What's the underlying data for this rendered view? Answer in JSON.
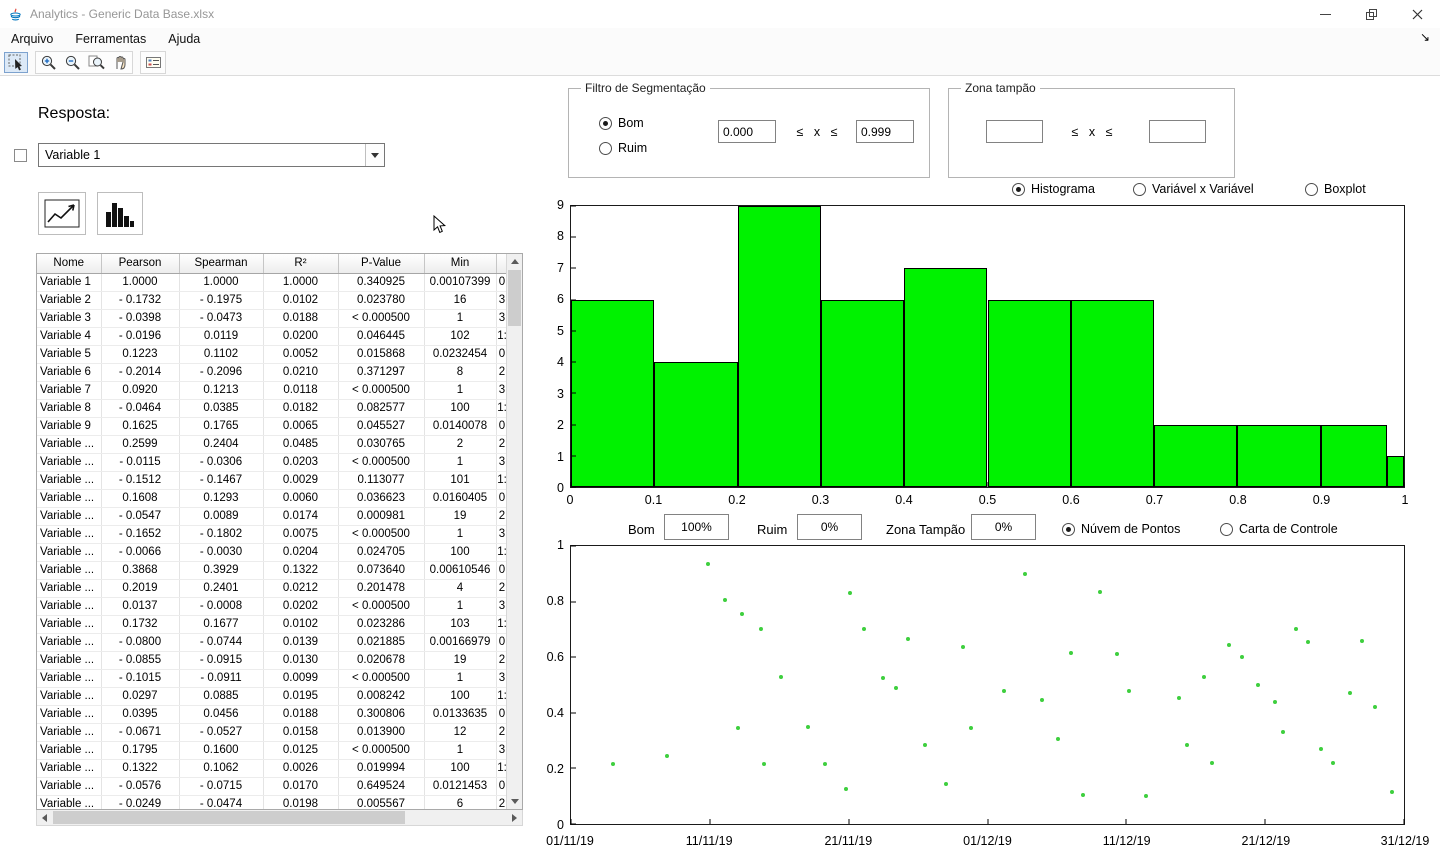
{
  "window": {
    "title": "Analytics - Generic Data Base.xlsx"
  },
  "menu": {
    "arquivo": "Arquivo",
    "ferramentas": "Ferramentas",
    "ajuda": "Ajuda"
  },
  "icons": {
    "dock_arrow": "↘"
  },
  "left_panel": {
    "resposta_label": "Resposta:",
    "variable_selector_value": "Variable 1",
    "table": {
      "headers": [
        "Nome",
        "Pearson",
        "Spearman",
        "R²",
        "P-Value",
        "Min",
        ""
      ],
      "rows": [
        [
          "Variable 1",
          "1.0000",
          "1.0000",
          "1.0000",
          "0.340925",
          "0.00107399",
          "0"
        ],
        [
          "Variable 2",
          "- 0.1732",
          "- 0.1975",
          "0.0102",
          "0.023780",
          "16",
          "3"
        ],
        [
          "Variable 3",
          "- 0.0398",
          "- 0.0473",
          "0.0188",
          "< 0.000500",
          "1",
          "3"
        ],
        [
          "Variable 4",
          "- 0.0196",
          "0.0119",
          "0.0200",
          "0.046445",
          "102",
          "1:"
        ],
        [
          "Variable 5",
          "0.1223",
          "0.1102",
          "0.0052",
          "0.015868",
          "0.0232454",
          "0"
        ],
        [
          "Variable 6",
          "- 0.2014",
          "- 0.2096",
          "0.0210",
          "0.371297",
          "8",
          "2"
        ],
        [
          "Variable 7",
          "0.0920",
          "0.1213",
          "0.0118",
          "< 0.000500",
          "1",
          "3"
        ],
        [
          "Variable 8",
          "- 0.0464",
          "0.0385",
          "0.0182",
          "0.082577",
          "100",
          "1:"
        ],
        [
          "Variable 9",
          "0.1625",
          "0.1765",
          "0.0065",
          "0.045527",
          "0.0140078",
          "0"
        ],
        [
          "Variable ...",
          "0.2599",
          "0.2404",
          "0.0485",
          "0.030765",
          "2",
          "2"
        ],
        [
          "Variable ...",
          "- 0.0115",
          "- 0.0306",
          "0.0203",
          "< 0.000500",
          "1",
          "3"
        ],
        [
          "Variable ...",
          "- 0.1512",
          "- 0.1467",
          "0.0029",
          "0.113077",
          "101",
          "1:"
        ],
        [
          "Variable ...",
          "0.1608",
          "0.1293",
          "0.0060",
          "0.036623",
          "0.0160405",
          "0"
        ],
        [
          "Variable ...",
          "- 0.0547",
          "0.0089",
          "0.0174",
          "0.000981",
          "19",
          "2"
        ],
        [
          "Variable ...",
          "- 0.1652",
          "- 0.1802",
          "0.0075",
          "< 0.000500",
          "1",
          "3"
        ],
        [
          "Variable ...",
          "- 0.0066",
          "- 0.0030",
          "0.0204",
          "0.024705",
          "100",
          "1:"
        ],
        [
          "Variable ...",
          "0.3868",
          "0.3929",
          "0.1322",
          "0.073640",
          "0.00610546",
          "0"
        ],
        [
          "Variable ...",
          "0.2019",
          "0.2401",
          "0.0212",
          "0.201478",
          "4",
          "2"
        ],
        [
          "Variable ...",
          "0.0137",
          "- 0.0008",
          "0.0202",
          "< 0.000500",
          "1",
          "3"
        ],
        [
          "Variable ...",
          "0.1732",
          "0.1677",
          "0.0102",
          "0.023286",
          "103",
          "1:"
        ],
        [
          "Variable ...",
          "- 0.0800",
          "- 0.0744",
          "0.0139",
          "0.021885",
          "0.00166979",
          "0"
        ],
        [
          "Variable ...",
          "- 0.0855",
          "- 0.0915",
          "0.0130",
          "0.020678",
          "19",
          "2"
        ],
        [
          "Variable ...",
          "- 0.1015",
          "- 0.0911",
          "0.0099",
          "< 0.000500",
          "1",
          "3"
        ],
        [
          "Variable ...",
          "0.0297",
          "0.0885",
          "0.0195",
          "0.008242",
          "100",
          "1:"
        ],
        [
          "Variable ...",
          "0.0395",
          "0.0456",
          "0.0188",
          "0.300806",
          "0.0133635",
          "0"
        ],
        [
          "Variable ...",
          "- 0.0671",
          "- 0.0527",
          "0.0158",
          "0.013900",
          "12",
          "2"
        ],
        [
          "Variable ...",
          "0.1795",
          "0.1600",
          "0.0125",
          "< 0.000500",
          "1",
          "3"
        ],
        [
          "Variable ...",
          "0.1322",
          "0.1062",
          "0.0026",
          "0.019994",
          "100",
          "1:"
        ],
        [
          "Variable ...",
          "- 0.0576",
          "- 0.0715",
          "0.0170",
          "0.649524",
          "0.0121453",
          "0"
        ],
        [
          "Variable ...",
          "- 0.0249",
          "- 0.0474",
          "0.0198",
          "0.005567",
          "6",
          "2"
        ]
      ]
    }
  },
  "segmentation": {
    "title": "Filtro de Segmentação",
    "option_bom": "Bom",
    "option_ruim": "Ruim",
    "selected": "Bom",
    "min_value": "0.000",
    "max_value": "0.999",
    "range_symbol": "≤ x ≤"
  },
  "buffer_zone": {
    "title": "Zona tampão",
    "min_value": "",
    "max_value": "",
    "range_symbol": "≤ x ≤"
  },
  "chart_mode": {
    "histograma": "Histograma",
    "var_x_var": "Variável x Variável",
    "boxplot": "Boxplot",
    "selected": "Histograma"
  },
  "stats_row": {
    "bom_label": "Bom",
    "bom_value": "100%",
    "ruim_label": "Ruim",
    "ruim_value": "0%",
    "zona_label": "Zona Tampão",
    "zona_value": "0%",
    "nuvem_label": "Núvem de Pontos",
    "carta_label": "Carta de Controle",
    "selected": "Núvem de Pontos"
  },
  "chart_data": [
    {
      "type": "bar",
      "title": "Histograma",
      "xlabel": "",
      "ylabel": "",
      "xlim": [
        0,
        1
      ],
      "ylim": [
        0,
        9
      ],
      "grid": false,
      "bar_color": "#00f200",
      "edge_color": "#000000",
      "xticks": [
        "0",
        "0.1",
        "0.2",
        "0.3",
        "0.4",
        "0.5",
        "0.6",
        "0.7",
        "0.8",
        "0.9",
        "1"
      ],
      "yticks": [
        "0",
        "1",
        "2",
        "3",
        "4",
        "5",
        "6",
        "7",
        "8",
        "9"
      ],
      "bars": [
        {
          "x0": 0.0,
          "x1": 0.1,
          "height": 6
        },
        {
          "x0": 0.1,
          "x1": 0.2,
          "height": 4
        },
        {
          "x0": 0.2,
          "x1": 0.3,
          "height": 9
        },
        {
          "x0": 0.3,
          "x1": 0.4,
          "height": 6
        },
        {
          "x0": 0.4,
          "x1": 0.5,
          "height": 7
        },
        {
          "x0": 0.5,
          "x1": 0.6,
          "height": 6
        },
        {
          "x0": 0.6,
          "x1": 0.7,
          "height": 6
        },
        {
          "x0": 0.7,
          "x1": 0.8,
          "height": 2
        },
        {
          "x0": 0.8,
          "x1": 0.9,
          "height": 2
        },
        {
          "x0": 0.9,
          "x1": 0.98,
          "height": 2
        },
        {
          "x0": 0.98,
          "x1": 1.0,
          "height": 1
        }
      ]
    },
    {
      "type": "scatter",
      "title": "Núvem de Pontos",
      "xlabel": "",
      "ylabel": "",
      "x_type": "date",
      "ylim": [
        0,
        1
      ],
      "grid": false,
      "marker_color": "#3ecf3e",
      "yticks": [
        "0",
        "0.2",
        "0.4",
        "0.6",
        "0.8",
        "1"
      ],
      "xticks": [
        "01/11/19",
        "11/11/19",
        "21/11/19",
        "01/12/19",
        "11/12/19",
        "21/12/19",
        "31/12/19"
      ],
      "points": [
        [
          0.05,
          0.215
        ],
        [
          0.115,
          0.245
        ],
        [
          0.165,
          0.935
        ],
        [
          0.185,
          0.805
        ],
        [
          0.205,
          0.755
        ],
        [
          0.228,
          0.7
        ],
        [
          0.2,
          0.345
        ],
        [
          0.232,
          0.215
        ],
        [
          0.252,
          0.53
        ],
        [
          0.285,
          0.35
        ],
        [
          0.305,
          0.215
        ],
        [
          0.33,
          0.125
        ],
        [
          0.335,
          0.83
        ],
        [
          0.352,
          0.7
        ],
        [
          0.375,
          0.525
        ],
        [
          0.39,
          0.49
        ],
        [
          0.405,
          0.665
        ],
        [
          0.425,
          0.285
        ],
        [
          0.45,
          0.145
        ],
        [
          0.47,
          0.635
        ],
        [
          0.48,
          0.345
        ],
        [
          0.52,
          0.48
        ],
        [
          0.545,
          0.9
        ],
        [
          0.565,
          0.445
        ],
        [
          0.585,
          0.305
        ],
        [
          0.6,
          0.615
        ],
        [
          0.615,
          0.105
        ],
        [
          0.635,
          0.835
        ],
        [
          0.655,
          0.61
        ],
        [
          0.67,
          0.48
        ],
        [
          0.69,
          0.1
        ],
        [
          0.73,
          0.455
        ],
        [
          0.74,
          0.285
        ],
        [
          0.76,
          0.53
        ],
        [
          0.77,
          0.22
        ],
        [
          0.79,
          0.645
        ],
        [
          0.805,
          0.6
        ],
        [
          0.825,
          0.5
        ],
        [
          0.845,
          0.44
        ],
        [
          0.855,
          0.33
        ],
        [
          0.87,
          0.7
        ],
        [
          0.885,
          0.655
        ],
        [
          0.9,
          0.27
        ],
        [
          0.915,
          0.22
        ],
        [
          0.935,
          0.47
        ],
        [
          0.95,
          0.66
        ],
        [
          0.965,
          0.42
        ],
        [
          0.985,
          0.115
        ]
      ]
    }
  ]
}
